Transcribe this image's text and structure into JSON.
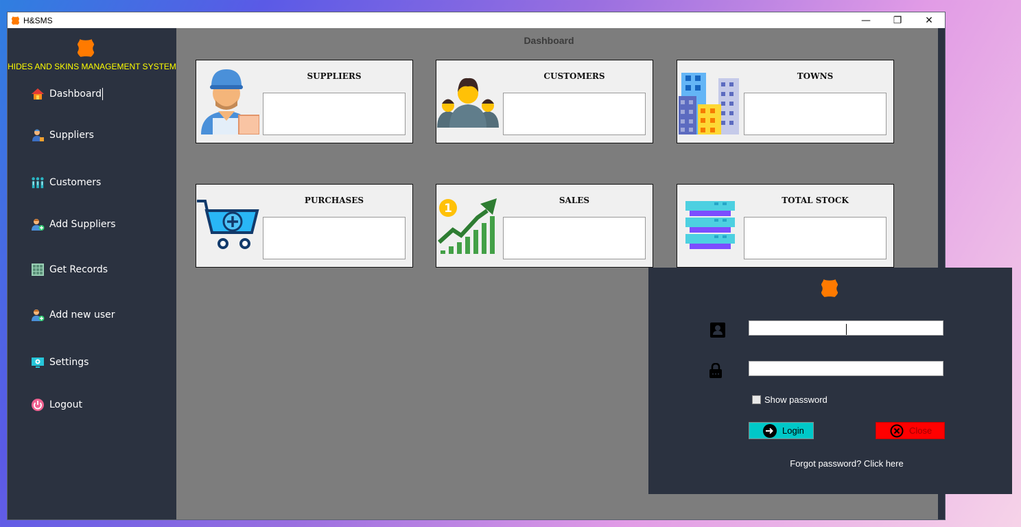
{
  "window": {
    "title": "H&SMS",
    "controls": {
      "minimize": "—",
      "restore": "❐",
      "close": "✕"
    }
  },
  "sidebar": {
    "brand": "HIDES AND SKINS MANAGEMENT SYSTEM",
    "items": [
      {
        "label": "Dashboard",
        "icon": "home-icon"
      },
      {
        "label": "Suppliers",
        "icon": "supplier-icon"
      },
      {
        "label": "Customers",
        "icon": "customers-icon"
      },
      {
        "label": "Add Suppliers",
        "icon": "add-supplier-icon"
      },
      {
        "label": "Get Records",
        "icon": "records-icon"
      },
      {
        "label": "Add new user",
        "icon": "add-user-icon"
      },
      {
        "label": "Settings",
        "icon": "settings-icon"
      },
      {
        "label": "Logout",
        "icon": "power-icon"
      }
    ]
  },
  "main": {
    "title": "Dashboard",
    "cards": [
      {
        "title": "SUPPLIERS",
        "value": "",
        "icon": "supplier-person-icon"
      },
      {
        "title": "CUSTOMERS",
        "value": "",
        "icon": "customers-group-icon"
      },
      {
        "title": "TOWNS",
        "value": "",
        "icon": "buildings-icon"
      },
      {
        "title": "PURCHASES",
        "value": "",
        "icon": "cart-icon"
      },
      {
        "title": "SALES",
        "value": "",
        "icon": "growth-chart-icon"
      },
      {
        "title": "TOTAL STOCK",
        "value": "",
        "icon": "stack-icon"
      }
    ]
  },
  "login": {
    "username_value": "",
    "password_value": "",
    "show_password_label": "Show password",
    "show_password_checked": false,
    "login_label": "Login",
    "close_label": "Close",
    "forgot_label": "Forgot password? Click here"
  },
  "colors": {
    "sidebar_bg": "#2b3240",
    "brand_text": "#ffff00",
    "main_bg": "#7d7d7d",
    "login_button": "#00c8c8",
    "close_button": "#ff0000",
    "logo": "#ff7a00"
  }
}
